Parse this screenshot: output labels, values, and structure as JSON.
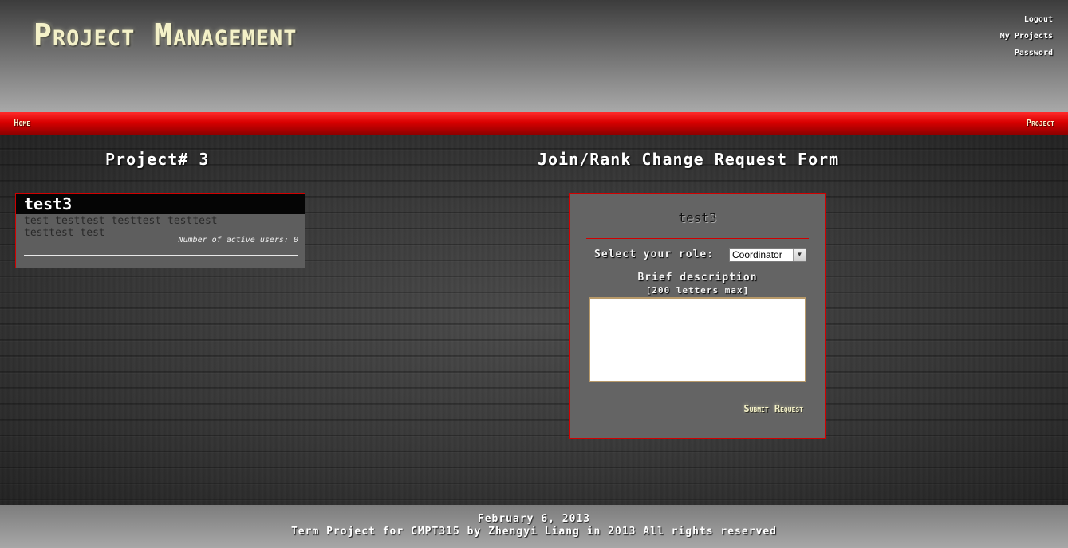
{
  "header": {
    "site_title": "Project Management",
    "links": [
      "Logout",
      "My Projects",
      "Password"
    ]
  },
  "nav": {
    "home": "Home",
    "project": "Project"
  },
  "main": {
    "left_heading": "Project# 3",
    "right_heading": "Join/Rank Change Request Form"
  },
  "project_card": {
    "title": "test3",
    "description": "test testtest testtest testtest testtest test",
    "active_users": "Number of active users: 0"
  },
  "form": {
    "project_name": "test3",
    "role_label": "Select your role:",
    "role_selected": "Coordinator",
    "description_label": "Brief description",
    "description_limit": "[200 letters max]",
    "description_value": "",
    "submit_label": "Submit Request"
  },
  "footer": {
    "date": "February 6, 2013",
    "copyright": "Term Project for CMPT315 by Zhengyi Liang in 2013 All rights reserved"
  },
  "colors": {
    "accent_red": "#d00000",
    "title_cream": "#f4f1c8"
  }
}
